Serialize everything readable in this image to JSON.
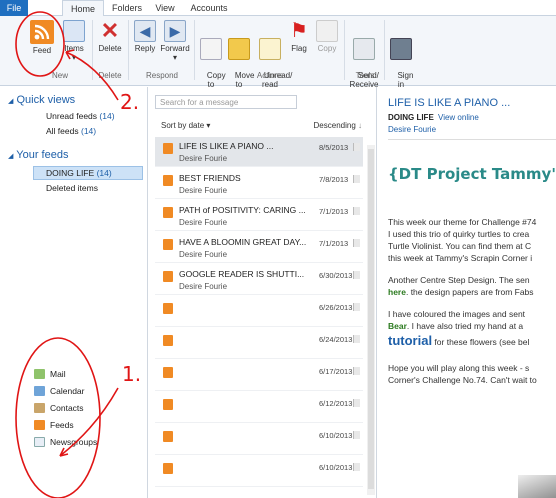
{
  "tabs": {
    "file": "File",
    "home": "Home",
    "folders": "Folders",
    "view": "View",
    "accounts": "Accounts"
  },
  "ribbon": {
    "feed": "Feed",
    "items": "Items",
    "delete": "Delete",
    "reply": "Reply",
    "forward": "Forward",
    "copy_to": "Copy\nto",
    "move_to": "Move\nto",
    "unread_read": "Unread/\nread",
    "flag": "Flag",
    "copy": "Copy",
    "send_receive": "Send/\nReceive",
    "sign_in": "Sign\nin",
    "groups": {
      "new": "New",
      "delete": "Delete",
      "respond": "Respond",
      "actions": "Actions",
      "tools": "Tools"
    }
  },
  "left": {
    "quick_views": "Quick views",
    "unread_feeds": "Unread feeds",
    "unread_count": "(14)",
    "all_feeds": "All feeds",
    "all_count": "(14)",
    "your_feeds": "Your feeds",
    "doing_life": "DOING LIFE",
    "doing_count": "(14)",
    "deleted_items": "Deleted items",
    "nav": [
      "Mail",
      "Calendar",
      "Contacts",
      "Feeds",
      "Newsgroups"
    ]
  },
  "list": {
    "search_placeholder": "Search for a message",
    "sort_by": "Sort by date",
    "descending": "Descending",
    "messages": [
      {
        "subject": "LIFE IS LIKE A PIANO ...",
        "from": "Desire Fourie",
        "date": "8/5/2013"
      },
      {
        "subject": "BEST FRIENDS",
        "from": "Desire Fourie",
        "date": "7/8/2013"
      },
      {
        "subject": "PATH of POSITIVITY: CARING ...",
        "from": "Desire Fourie",
        "date": "7/1/2013"
      },
      {
        "subject": "HAVE A BLOOMIN GREAT DAY...",
        "from": "Desire Fourie",
        "date": "7/1/2013"
      },
      {
        "subject": "GOOGLE READER IS SHUTTI...",
        "from": "Desire Fourie",
        "date": "6/30/2013"
      },
      {
        "subject": "",
        "from": "",
        "date": "6/26/2013"
      },
      {
        "subject": "",
        "from": "",
        "date": "6/24/2013"
      },
      {
        "subject": "",
        "from": "",
        "date": "6/17/2013"
      },
      {
        "subject": "",
        "from": "",
        "date": "6/12/2013"
      },
      {
        "subject": "",
        "from": "",
        "date": "6/10/2013"
      },
      {
        "subject": "",
        "from": "",
        "date": "6/10/2013"
      }
    ]
  },
  "reading": {
    "title": "LIFE IS LIKE A PIANO ...",
    "feed": "DOING LIFE",
    "view_online": "View online",
    "author": "Desire Fourie",
    "heading": "{DT Project Tammy's S",
    "p1": [
      "This week our theme for Challenge #74",
      "I used this trio of quirky turtles to crea",
      "Turtle Violinist.  You can find them at C",
      "this week at Tammy's Scrapin Corner i"
    ],
    "p2a": "Another Centre Step Design.  The sen",
    "p2_here": "here",
    "p2b": ".  the design papers are from Fabs",
    "p3a": "I have coloured  the images and sent",
    "p3_bear": "Bear",
    "p3b": ".  I have also tried my hand at a",
    "p3_tut": "tutorial",
    "p3c": " for these flowers (see bel",
    "p4": [
      "Hope you will play along this week - s",
      "Corner's Challenge No.74. Can't wait to"
    ]
  },
  "annotations": {
    "a1": "1.",
    "a2": "2."
  },
  "colors": {
    "accent": "#1e5fa8",
    "file_tab": "#1f6fc0",
    "rss": "#f08a24",
    "annotation": "#e01515",
    "heading": "#2a8a88"
  }
}
